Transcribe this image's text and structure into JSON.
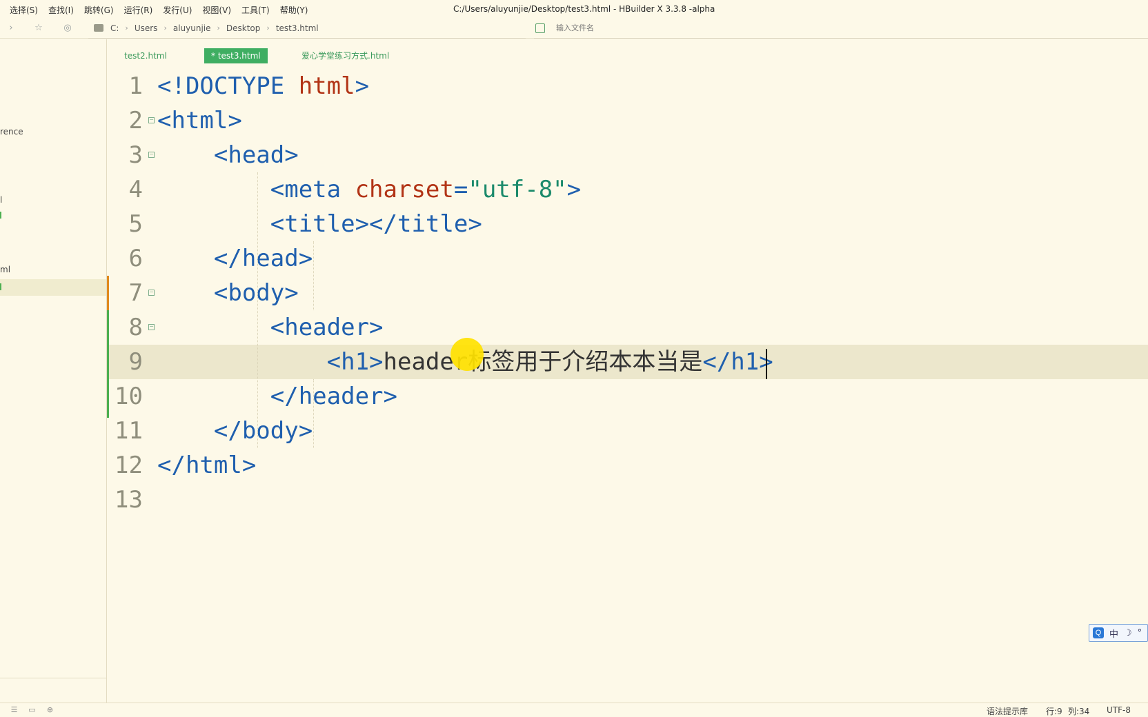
{
  "menubar": {
    "items": [
      "选择(S)",
      "查找(I)",
      "跳转(G)",
      "运行(R)",
      "发行(U)",
      "视图(V)",
      "工具(T)",
      "帮助(Y)"
    ],
    "window_title": "C:/Users/aluyunjie/Desktop/test3.html - HBuilder X 3.3.8 -alpha"
  },
  "toolbar": {
    "icons": [
      "forward-arrow-icon",
      "star-icon",
      "preview-icon",
      "folder-icon"
    ],
    "breadcrumb": [
      "C:",
      "Users",
      "aluyunjie",
      "Desktop",
      "test3.html"
    ],
    "file_search_placeholder": "输入文件名"
  },
  "left_panel": {
    "fragments": [
      "rence",
      "l",
      "ml"
    ]
  },
  "tabs": [
    {
      "label": "test2.html",
      "active": false
    },
    {
      "label": "* test3.html",
      "active": true
    },
    {
      "label": "爱心学堂练习方式.html",
      "active": false
    }
  ],
  "editor": {
    "lines": [
      {
        "n": "1",
        "tokens": [
          [
            "tag",
            "<!DOCTYPE "
          ],
          [
            "kw",
            "html"
          ],
          [
            "tag",
            ">"
          ]
        ]
      },
      {
        "n": "2",
        "tokens": [
          [
            "tag",
            "<html>"
          ]
        ]
      },
      {
        "n": "3",
        "tokens": [
          [
            "tag",
            "    <head>"
          ]
        ]
      },
      {
        "n": "4",
        "tokens": [
          [
            "tag",
            "        <meta "
          ],
          [
            "attr",
            "charset"
          ],
          [
            "tag",
            "="
          ],
          [
            "str",
            "\"utf-8\""
          ],
          [
            "tag",
            ">"
          ]
        ]
      },
      {
        "n": "5",
        "tokens": [
          [
            "tag",
            "        <title></title>"
          ]
        ]
      },
      {
        "n": "6",
        "tokens": [
          [
            "tag",
            "    </head>"
          ]
        ]
      },
      {
        "n": "7",
        "tokens": [
          [
            "tag",
            "    <body>"
          ]
        ]
      },
      {
        "n": "8",
        "tokens": [
          [
            "tag",
            "        <header>"
          ]
        ]
      },
      {
        "n": "9",
        "tokens": [
          [
            "tag",
            "            <h1>"
          ],
          [
            "txt",
            "header标签用于介绍本本当是"
          ],
          [
            "tag",
            "</h1>"
          ]
        ]
      },
      {
        "n": "10",
        "tokens": [
          [
            "tag",
            "        </header>"
          ]
        ]
      },
      {
        "n": "11",
        "tokens": [
          [
            "tag",
            "    </body>"
          ]
        ]
      },
      {
        "n": "12",
        "tokens": [
          [
            "tag",
            "</html>"
          ]
        ]
      },
      {
        "n": "13",
        "tokens": []
      }
    ],
    "current_line": 9
  },
  "ime": {
    "logo": "Q",
    "mode": "中",
    "moon": "☽",
    "dot": "°"
  },
  "statusbar": {
    "syntax_lib": "语法提示库",
    "row": "行:9",
    "col": "列:34",
    "encoding": "UTF-8"
  },
  "colors": {
    "background": "#fdf9e8",
    "tag": "#1f5fae",
    "keyword": "#b23416",
    "string": "#1b8a6b",
    "tab_active": "#3fae62",
    "git_modified": "#e08a1e",
    "git_added": "#4caf50"
  }
}
